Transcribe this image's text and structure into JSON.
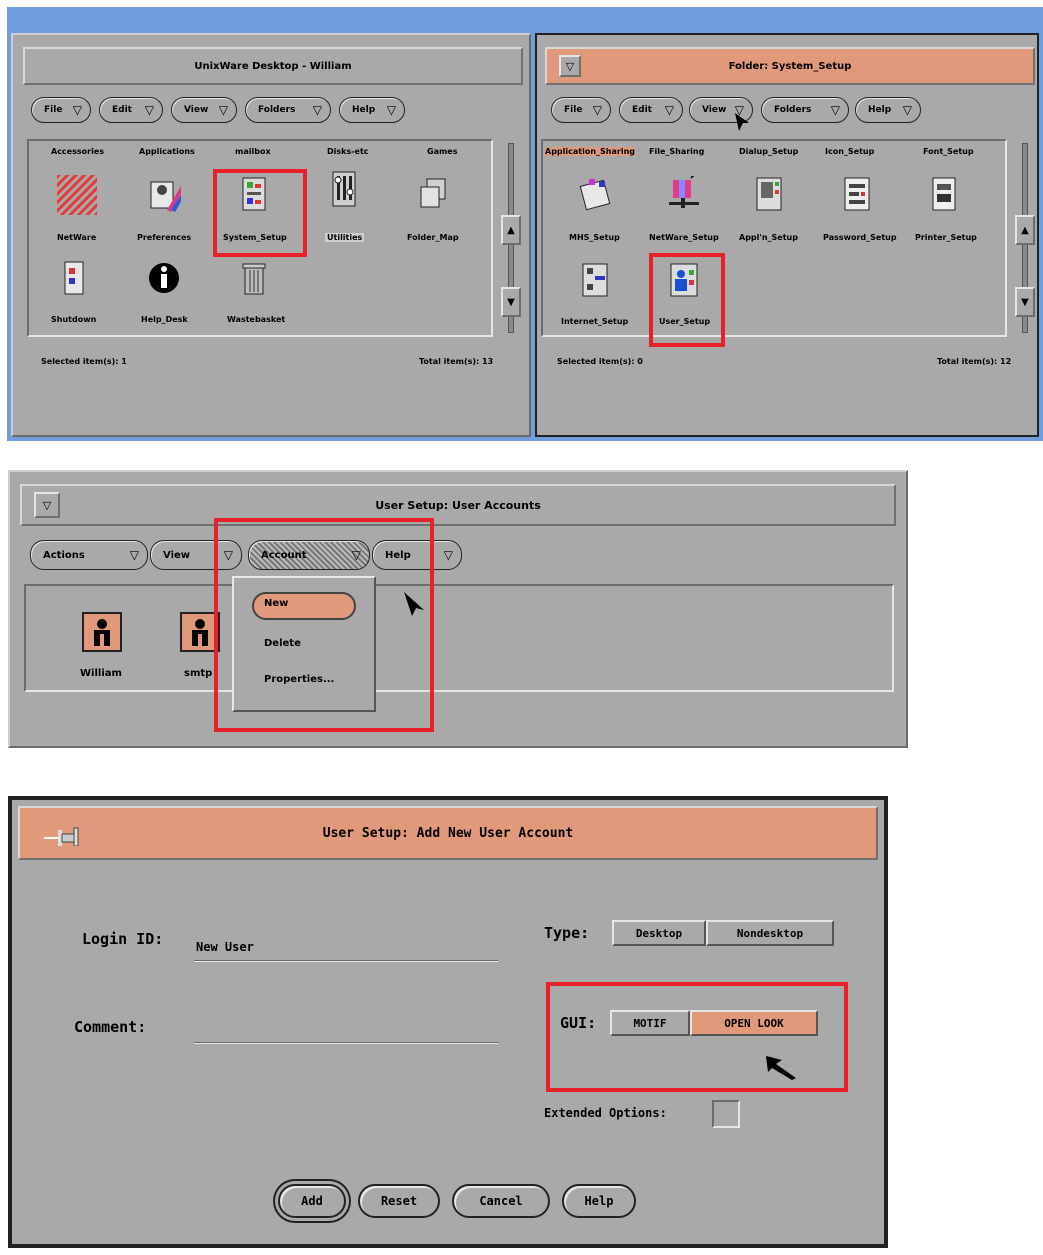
{
  "panel1": {
    "left_window": {
      "title": "UnixWare Desktop - William",
      "menus": [
        "File",
        "Edit",
        "View",
        "Folders",
        "Help"
      ],
      "headers": [
        "Accessories",
        "Applications",
        "mailbox",
        "Disks-etc",
        "Games"
      ],
      "items": [
        "NetWare",
        "Preferences",
        "System_Setup",
        "Utilities",
        "Folder_Map",
        "Shutdown",
        "Help_Desk",
        "Wastebasket"
      ],
      "status_left": "Selected item(s): 1",
      "status_right": "Total item(s): 13"
    },
    "right_window": {
      "title": "Folder: System_Setup",
      "menus": [
        "File",
        "Edit",
        "View",
        "Folders",
        "Help"
      ],
      "headers": [
        "Application_Sharing",
        "File_Sharing",
        "Dialup_Setup",
        "Icon_Setup",
        "Font_Setup"
      ],
      "items": [
        "MHS_Setup",
        "NetWare_Setup",
        "Appl'n_Setup",
        "Password_Setup",
        "Printer_Setup",
        "Internet_Setup",
        "User_Setup"
      ],
      "status_left": "Selected item(s): 0",
      "status_right": "Total item(s): 12"
    }
  },
  "panel2": {
    "title": "User Setup: User Accounts",
    "menus": [
      "Actions",
      "View",
      "Account",
      "Help"
    ],
    "users": [
      "William",
      "smtp"
    ],
    "account_menu": [
      "New",
      "Delete",
      "Properties..."
    ]
  },
  "panel3": {
    "title": "User Setup: Add New User Account",
    "login_label": "Login ID:",
    "login_value": "New User",
    "comment_label": "Comment:",
    "type_label": "Type:",
    "type_options": [
      "Desktop",
      "Nondesktop"
    ],
    "gui_label": "GUI:",
    "gui_options": [
      "MOTIF",
      "OPEN LOOK"
    ],
    "extended_label": "Extended Options:",
    "buttons": [
      "Add",
      "Reset",
      "Cancel",
      "Help"
    ]
  },
  "colors": {
    "window_gray": "#a9a9a9",
    "active_title": "#e0997a",
    "highlight_red": "#e8202a",
    "frame_blue": "#6f9de0"
  }
}
